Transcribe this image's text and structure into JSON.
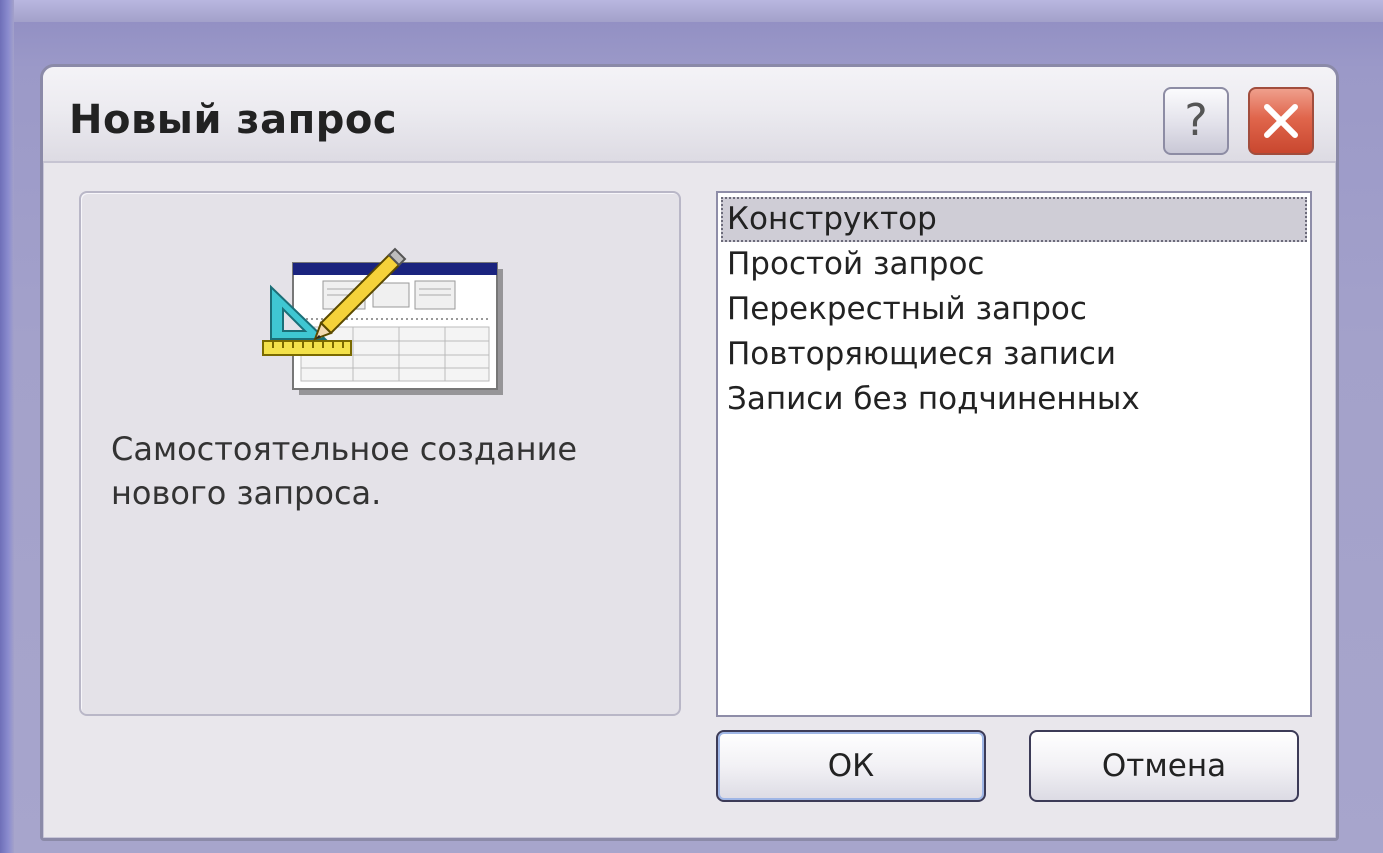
{
  "dialog": {
    "title": "Новый запрос",
    "help_label": "?",
    "description": "Самостоятельное создание нового запроса.",
    "list_items": [
      "Конструктор",
      "Простой запрос",
      "Перекрестный запрос",
      "Повторяющиеся записи",
      "Записи без подчиненных"
    ],
    "selected_index": 0,
    "ok_label": "ОК",
    "cancel_label": "Отмена"
  },
  "colors": {
    "background": "#a3a1ca",
    "dialog_face": "#e9e7ec",
    "close_button": "#e0664c",
    "selection": "#cfcdd6"
  },
  "icons": {
    "title_help": "question-mark-icon",
    "title_close": "close-x-icon",
    "wizard": "design-view-pencil-ruler-icon"
  }
}
